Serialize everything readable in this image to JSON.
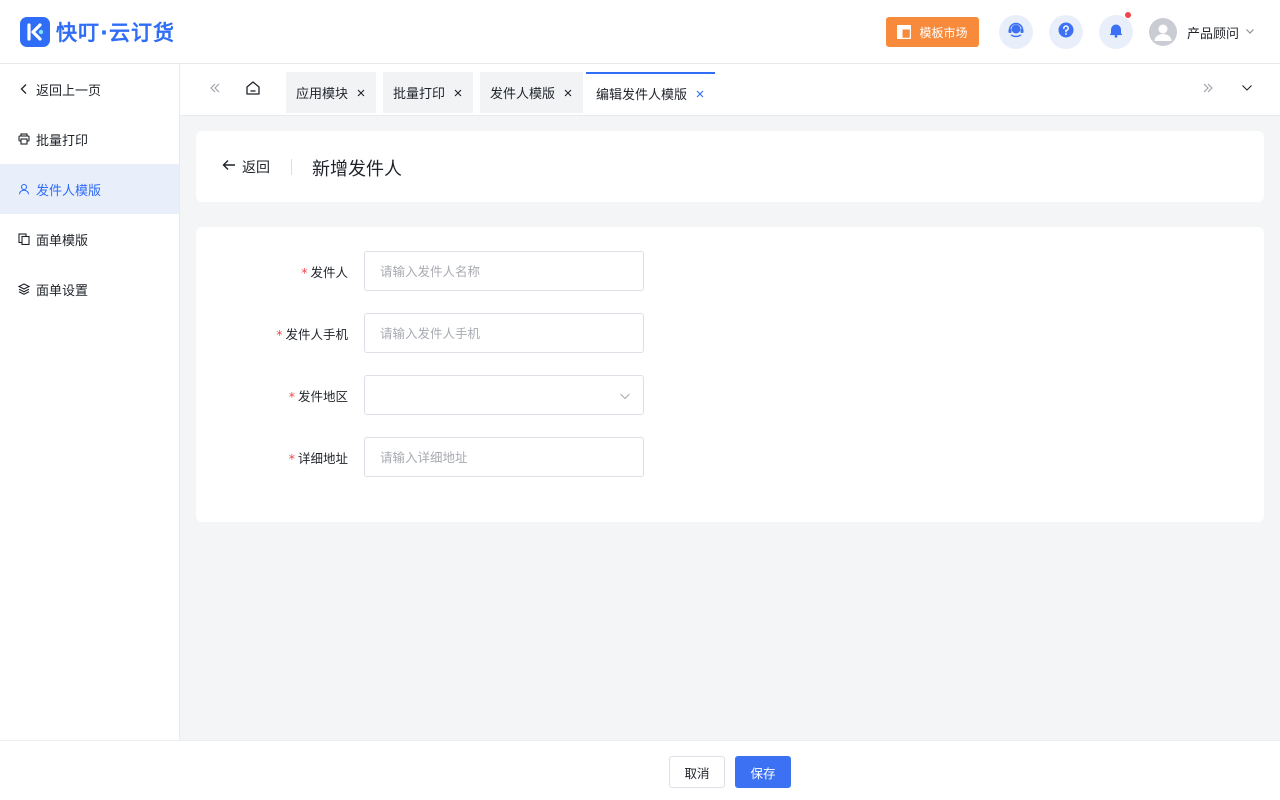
{
  "header": {
    "logo_text": "快叮·云订货",
    "market_label": "模板市场",
    "user_name": "产品顾问"
  },
  "sidebar": {
    "items": [
      {
        "label": "返回上一页",
        "icon": "chevron-left-icon"
      },
      {
        "label": "批量打印",
        "icon": "printer-icon"
      },
      {
        "label": "发件人模版",
        "icon": "user-icon",
        "active": true
      },
      {
        "label": "面单模版",
        "icon": "copy-icon"
      },
      {
        "label": "面单设置",
        "icon": "stack-icon"
      }
    ]
  },
  "tabs": [
    {
      "label": "应用模块"
    },
    {
      "label": "批量打印"
    },
    {
      "label": "发件人模版"
    },
    {
      "label": "编辑发件人模版",
      "active": true
    }
  ],
  "page": {
    "back_label": "返回",
    "title": "新增发件人"
  },
  "form": {
    "required_mark": "*",
    "fields": [
      {
        "label": "发件人",
        "placeholder": "请输入发件人名称",
        "value": ""
      },
      {
        "label": "发件人手机",
        "placeholder": "请输入发件人手机",
        "value": ""
      },
      {
        "label": "发件地区",
        "placeholder": "",
        "value": ""
      },
      {
        "label": "详细地址",
        "placeholder": "请输入详细地址",
        "value": ""
      }
    ]
  },
  "footer": {
    "cancel_label": "取消",
    "save_label": "保存"
  },
  "colors": {
    "primary": "#2f6df6",
    "market_orange": "#f88b3b",
    "required_red": "#f0464b"
  }
}
